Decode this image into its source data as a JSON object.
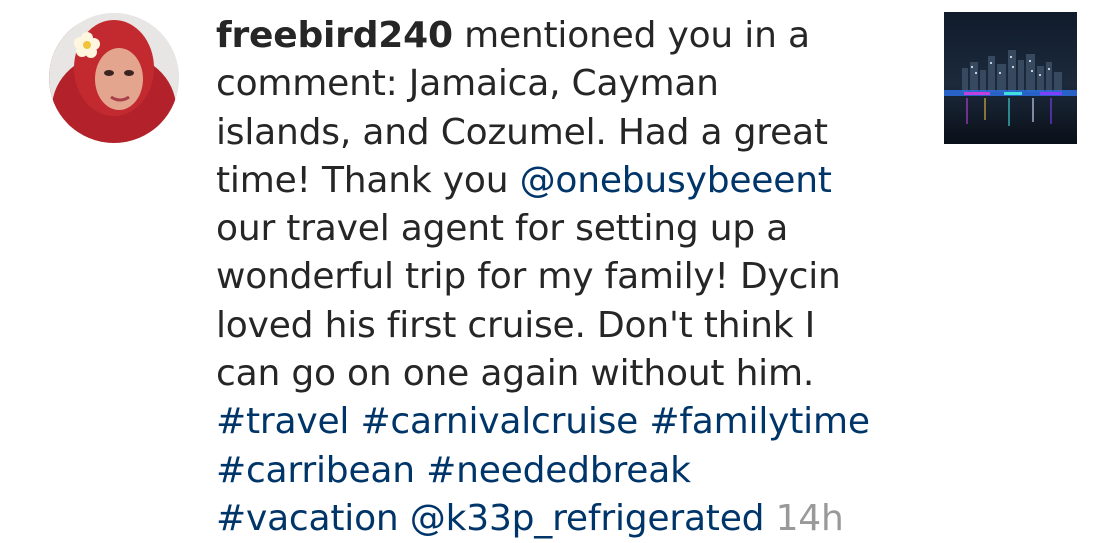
{
  "notification": {
    "username": "freebird240",
    "action_text": " mentioned you in a",
    "comment_lines": [
      "comment: Jamaica, Cayman",
      "islands, and Cozumel. Had a great"
    ],
    "line4_prefix": "time! Thank you ",
    "mention_1": "@onebusybeeent",
    "comment_lines_2": [
      "our travel agent for setting up a",
      "wonderful trip for my family! Dycin",
      "loved his first cruise. Don't think I",
      "can go on one again without him."
    ],
    "hashtags_line_1": "#travel #carnivalcruise #familytime",
    "hashtags_line_2": "#carribean #neededbreak",
    "hashtag_vacation": "#vacation",
    "mention_2": "@k33p_refrigerated",
    "timestamp": "14h",
    "avatar_icon": "user-avatar",
    "thumbnail_icon": "post-thumbnail-city-night",
    "colors": {
      "text": "#262626",
      "link": "#003569",
      "timestamp": "#999999"
    }
  }
}
